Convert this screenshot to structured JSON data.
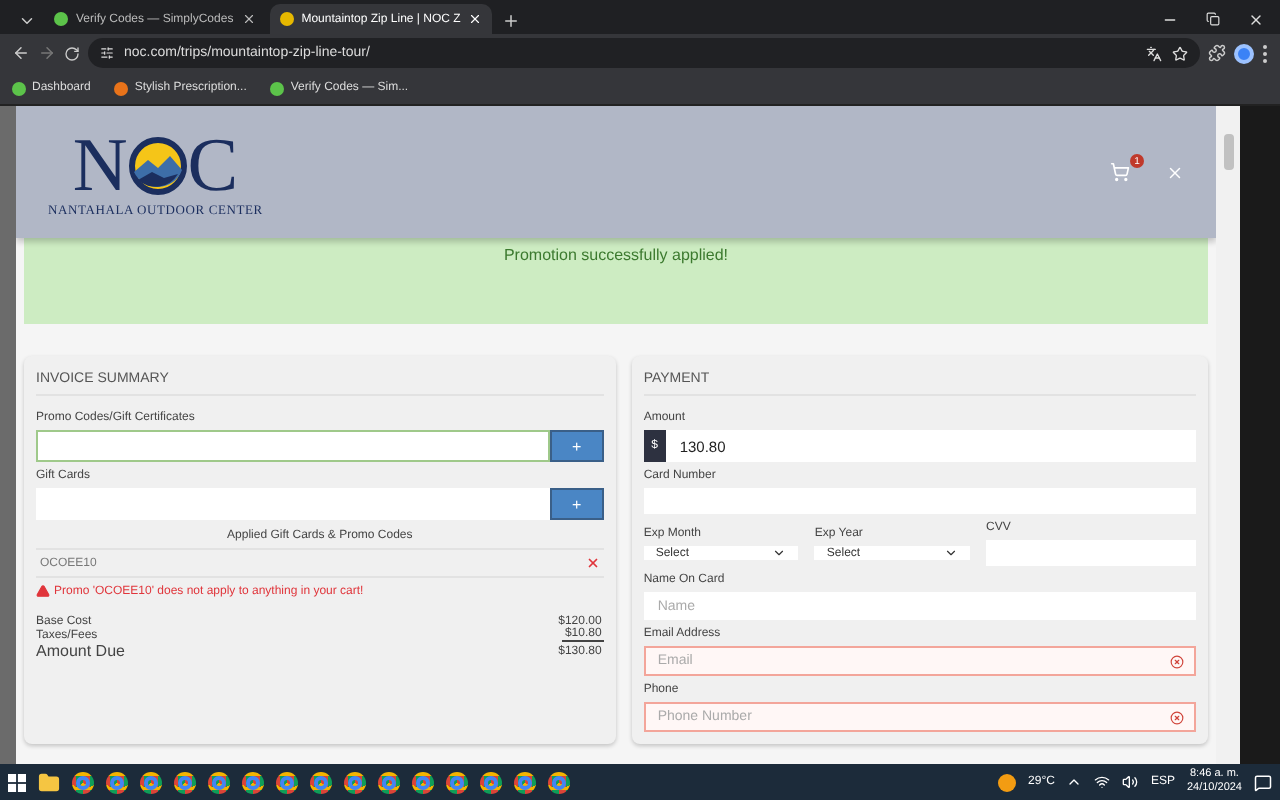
{
  "browser": {
    "tabs": [
      {
        "title": "Verify Codes — SimplyCodes",
        "selected": false
      },
      {
        "title": "Mountaintop Zip Line | NOC Z",
        "selected": true
      }
    ],
    "url": "noc.com/trips/mountaintop-zip-line-tour/",
    "bookmarks": [
      {
        "label": "Dashboard",
        "color": "#5cc34a"
      },
      {
        "label": "Stylish Prescription...",
        "color": "#e8731a"
      },
      {
        "label": "Verify Codes — Sim...",
        "color": "#5cc34a"
      }
    ]
  },
  "header": {
    "logo_left": "N",
    "logo_right": "C",
    "tagline": "NANTAHALA OUTDOOR CENTER",
    "cart_count": "1"
  },
  "banner": "Promotion successfully applied!",
  "invoice": {
    "title": "INVOICE SUMMARY",
    "promo_label": "Promo Codes/Gift Certificates",
    "promo_button": "+",
    "gift_label": "Gift Cards",
    "gift_button": "+",
    "applied_title": "Applied Gift Cards & Promo Codes",
    "codes": [
      {
        "code": "OCOEE10"
      }
    ],
    "error": "Promo 'OCOEE10' does not apply to anything in your cart!",
    "lines": [
      {
        "label": "Base Cost",
        "value": "$120.00",
        "kind": "plain"
      },
      {
        "label": "Taxes/Fees",
        "value": "$10.80",
        "kind": "subtotal"
      },
      {
        "label": "Amount Due",
        "value": "$130.80",
        "kind": "total"
      }
    ]
  },
  "payment": {
    "title": "PAYMENT",
    "amount_label": "Amount",
    "currency": "$",
    "amount": "130.80",
    "card_label": "Card Number",
    "month_label": "Exp Month",
    "month_value": "Select",
    "year_label": "Exp Year",
    "year_value": "Select",
    "cvv_label": "CVV",
    "name_label": "Name On Card",
    "name_placeholder": "Name",
    "email_label": "Email Address",
    "email_placeholder": "Email",
    "email_invalid": true,
    "phone_label": "Phone",
    "phone_placeholder": "Phone Number",
    "phone_invalid": true
  },
  "taskbar": {
    "weather": "29°C",
    "language": "ESP",
    "time": "8:46 a. m.",
    "date": "24/10/2024"
  }
}
